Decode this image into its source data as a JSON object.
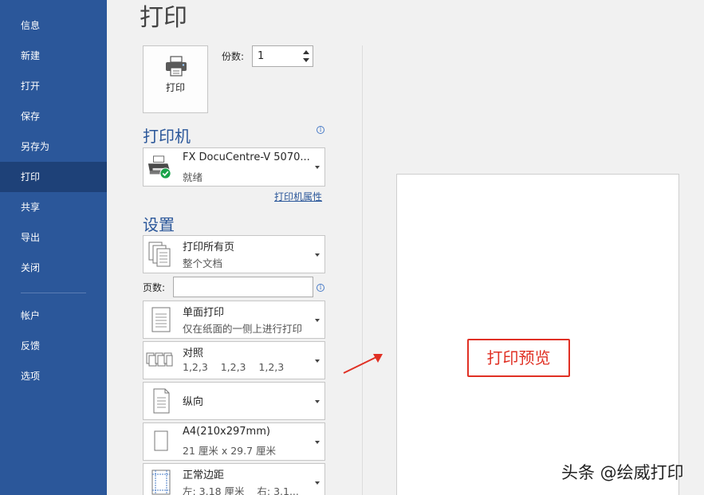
{
  "sidebar": {
    "items": [
      {
        "label": "信息"
      },
      {
        "label": "新建"
      },
      {
        "label": "打开"
      },
      {
        "label": "保存"
      },
      {
        "label": "另存为"
      },
      {
        "label": "打印",
        "active": true
      },
      {
        "label": "共享"
      },
      {
        "label": "导出"
      },
      {
        "label": "关闭"
      },
      {
        "label": "帐户"
      },
      {
        "label": "反馈"
      },
      {
        "label": "选项"
      }
    ]
  },
  "page_title": "打印",
  "print_button": {
    "label": "打印",
    "icon": "printer-icon"
  },
  "copies": {
    "label": "份数:",
    "value": "1"
  },
  "printer": {
    "section_title": "打印机",
    "name": "FX DocuCentre-V 5070...",
    "status": "就绪",
    "properties_link": "打印机属性"
  },
  "settings": {
    "section_title": "设置",
    "range": {
      "main": "打印所有页",
      "sub": "整个文档"
    },
    "pages_label": "页数:",
    "pages_value": "",
    "sides": {
      "main": "单面打印",
      "sub": "仅在纸面的一侧上进行打印"
    },
    "collate": {
      "main": "对照",
      "sub": "1,2,3    1,2,3    1,2,3"
    },
    "orientation": {
      "main": "纵向"
    },
    "paper": {
      "main": "A4(210x297mm)",
      "sub": "21 厘米 x 29.7 厘米"
    },
    "margins": {
      "main": "正常边距",
      "sub": "左: 3.18 厘米    右: 3.1..."
    }
  },
  "preview": {
    "callout": "打印预览"
  },
  "watermark": "头条 @绘威打印",
  "colors": {
    "sidebar": "#2b579a",
    "sidebar_active": "#1e4178",
    "accent": "#2b579a",
    "callout": "#e03024"
  }
}
